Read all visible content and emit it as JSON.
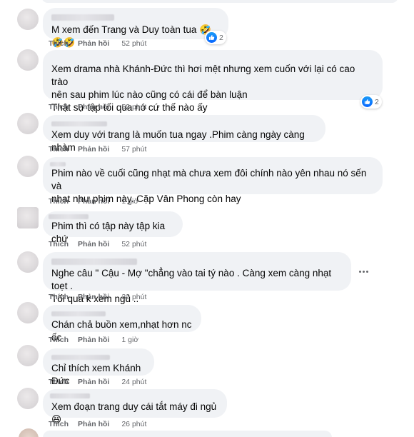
{
  "actions": {
    "like": "Thích",
    "reply": "Phản hồi"
  },
  "comments": [
    {
      "text": "M xem đến Trang và Duy toàn tua 🤣🤣🤣",
      "time": "52 phút",
      "reaction_count": "2"
    },
    {
      "text": "Xem drama nhà Khánh-Đức thì hơi mệt nhưng xem cuốn với lại có cao trào\nnên sau phim lúc nào cũng có cái để bàn luận\nThật sự tập tối qua nó cứ thế nào ấy",
      "time": "52 phút",
      "reaction_count": "2"
    },
    {
      "text": "Xem duy với trang là muốn tua ngay .Phim càng ngày càng nhàm",
      "time": "57 phút"
    },
    {
      "text": "Phim nào về cuối cũng nhạt mà chưa xem đôi chính nào yên nhau nó sến và\nnhạt như phim này. Cặp Vân Phong còn hay",
      "time": "1 giờ"
    },
    {
      "text": "Phim thì có tập này tập kia chứ",
      "time": "52 phút"
    },
    {
      "text": "Nghe câu \" Cậu - Mợ \"chẳng vào tai tý nào . Càng xem càng nhạt toẹt .\nTối qua k xem ngủ ..",
      "time": "32 phút"
    },
    {
      "text": "Chán chả buồn xem,nhạt hơn nc ốc",
      "time": "1 giờ"
    },
    {
      "text": "Chỉ thích xem Khánh Đức",
      "time": "24 phút"
    },
    {
      "text": "Xem đoạn trang duy cái tắt máy đi ngủ😆",
      "time": "26 phút"
    }
  ],
  "icons": {
    "reaction": "like-icon",
    "more": "more-options-icon"
  },
  "colors": {
    "bubble": "#f0f2f5",
    "meta": "#65676b",
    "like": "#0866ff"
  }
}
